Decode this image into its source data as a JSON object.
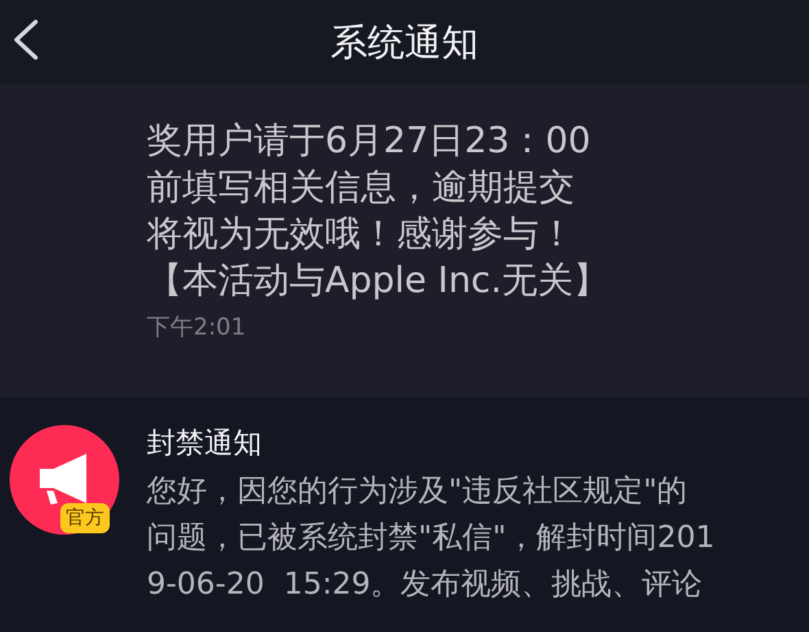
{
  "header": {
    "title": "系统通知"
  },
  "messages": [
    {
      "kind": "text",
      "lines": [
        "奖用户请于6月27日23：00",
        "前填写相关信息，逾期提交",
        "将视为无效哦！感谢参与！",
        "【本活动与Apple Inc.无关】"
      ],
      "time": "下午2:01"
    },
    {
      "kind": "notice",
      "title": "封禁通知",
      "badge": "官方",
      "lines": [
        "您好，因您的行为涉及\"违反社区规定\"的",
        "问题，已被系统封禁\"私信\"，解封时间201",
        "9-06-20  15:29。发布视频、挑战、评论"
      ]
    }
  ]
}
